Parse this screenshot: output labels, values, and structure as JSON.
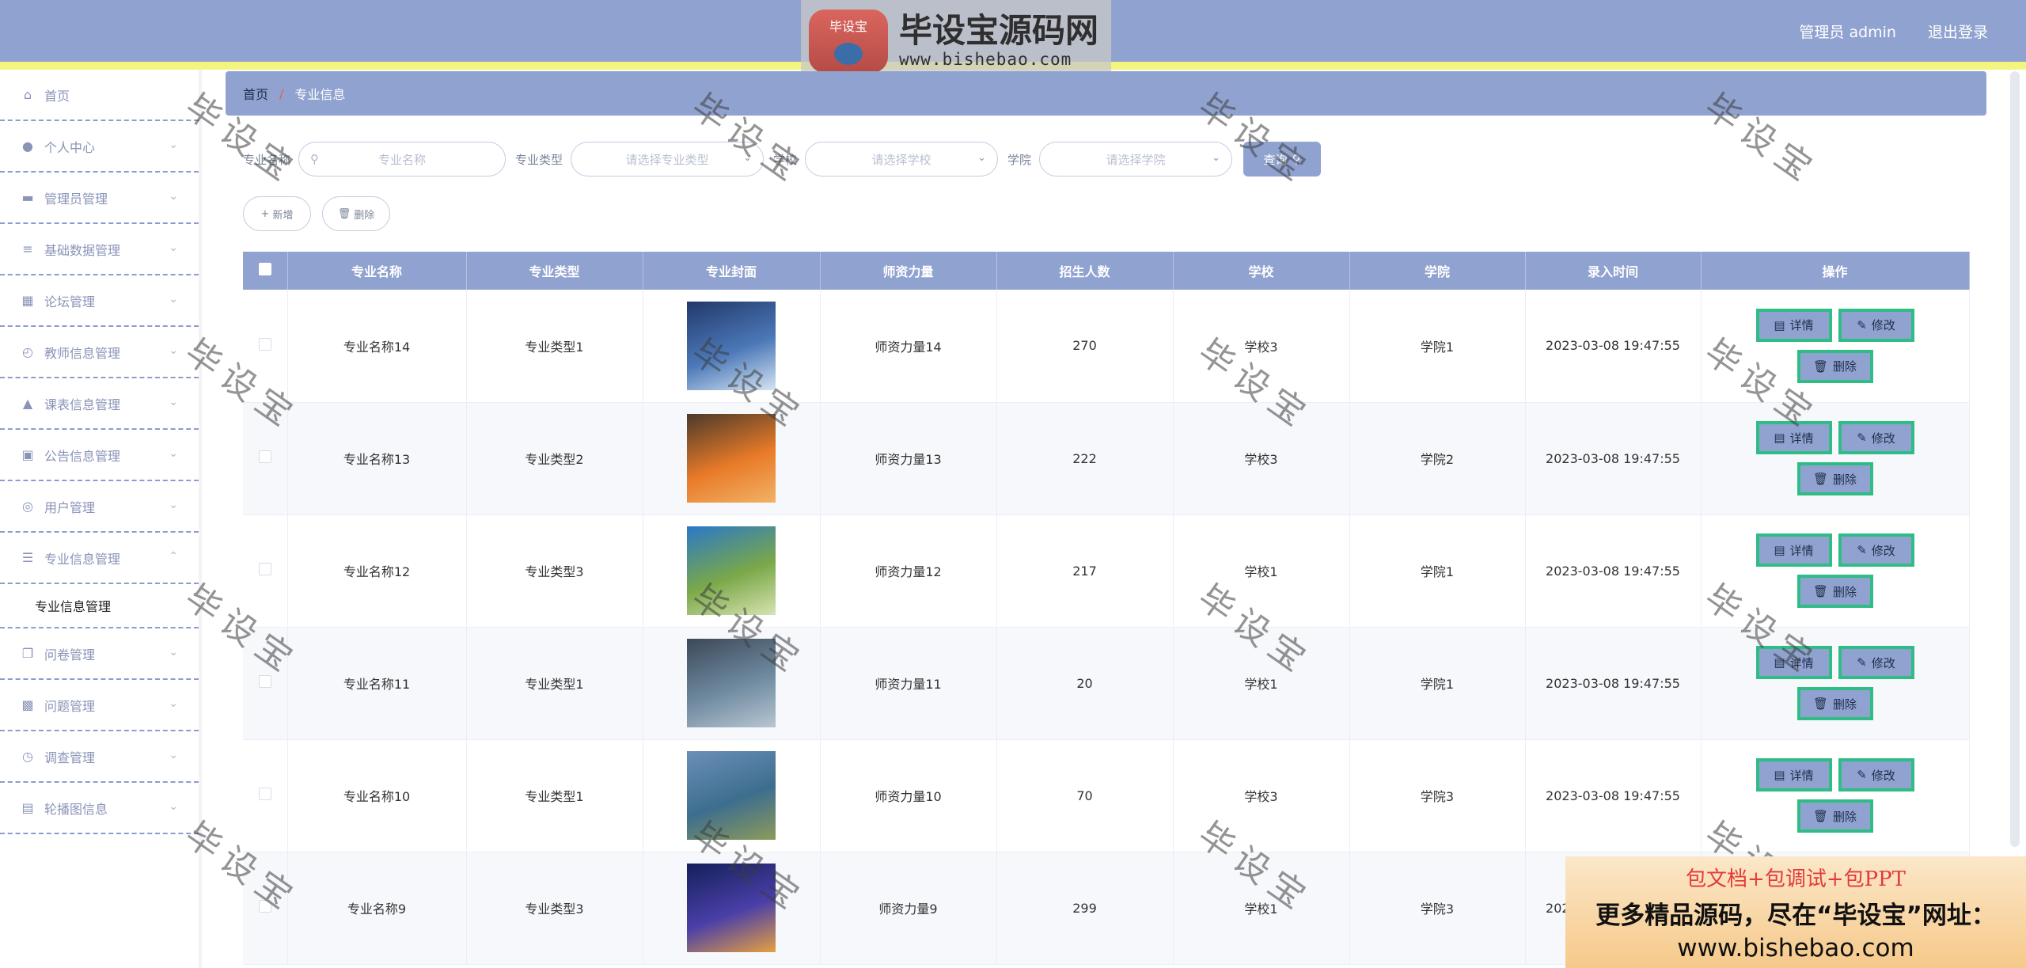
{
  "header": {
    "user_label": "管理员 admin",
    "logout_label": "退出登录"
  },
  "watermark": {
    "logo_badge": "毕设宝",
    "logo_title": "毕设宝源码网",
    "logo_url": "www.bishebao.com",
    "tile_text": "毕设宝"
  },
  "sidebar": {
    "items": [
      {
        "label": "首页",
        "icon": "home-icon"
      },
      {
        "label": "个人中心",
        "icon": "user-icon"
      },
      {
        "label": "管理员管理",
        "icon": "admin-icon"
      },
      {
        "label": "基础数据管理",
        "icon": "sliders-icon"
      },
      {
        "label": "论坛管理",
        "icon": "grid-icon"
      },
      {
        "label": "教师信息管理",
        "icon": "compass-icon"
      },
      {
        "label": "课表信息管理",
        "icon": "person-icon"
      },
      {
        "label": "公告信息管理",
        "icon": "monitor-icon"
      },
      {
        "label": "用户管理",
        "icon": "circle-icon"
      },
      {
        "label": "专业信息管理",
        "icon": "list-icon"
      },
      {
        "label": "问卷管理",
        "icon": "copy-icon"
      },
      {
        "label": "问题管理",
        "icon": "chat-icon"
      },
      {
        "label": "调查管理",
        "icon": "gauge-icon"
      },
      {
        "label": "轮播图信息",
        "icon": "briefcase-icon"
      }
    ],
    "submenu_active": "专业信息管理"
  },
  "breadcrumb": {
    "home": "首页",
    "separator": "/",
    "current": "专业信息"
  },
  "search": {
    "name_label": "专业名称",
    "name_placeholder": "专业名称",
    "type_label": "专业类型",
    "type_placeholder": "请选择专业类型",
    "school_label": "学校",
    "school_placeholder": "请选择学校",
    "college_label": "学院",
    "college_placeholder": "请选择学院",
    "button": "查询"
  },
  "actions": {
    "add": "新增",
    "delete": "删除"
  },
  "table": {
    "headers": [
      "专业名称",
      "专业类型",
      "专业封面",
      "师资力量",
      "招生人数",
      "学校",
      "学院",
      "录入时间",
      "操作"
    ],
    "ops": {
      "detail": "详情",
      "edit": "修改",
      "delete": "删除"
    },
    "rows": [
      {
        "name": "专业名称14",
        "type": "专业类型1",
        "teachers": "师资力量14",
        "count": "270",
        "school": "学校3",
        "college": "学院1",
        "time": "2023-03-08 19:47:55",
        "cover": [
          "#22386a",
          "#4b78b8",
          "#d6e4f2"
        ]
      },
      {
        "name": "专业名称13",
        "type": "专业类型2",
        "teachers": "师资力量13",
        "count": "222",
        "school": "学校3",
        "college": "学院2",
        "time": "2023-03-08 19:47:55",
        "cover": [
          "#4a3a2a",
          "#e87a28",
          "#f2b266"
        ]
      },
      {
        "name": "专业名称12",
        "type": "专业类型3",
        "teachers": "师资力量12",
        "count": "217",
        "school": "学校1",
        "college": "学院1",
        "time": "2023-03-08 19:47:55",
        "cover": [
          "#2a78c8",
          "#7aa848",
          "#d7e3b2"
        ]
      },
      {
        "name": "专业名称11",
        "type": "专业类型1",
        "teachers": "师资力量11",
        "count": "20",
        "school": "学校1",
        "college": "学院1",
        "time": "2023-03-08 19:47:55",
        "cover": [
          "#3c4858",
          "#6f8aa0",
          "#b8c6d2"
        ]
      },
      {
        "name": "专业名称10",
        "type": "专业类型1",
        "teachers": "师资力量10",
        "count": "70",
        "school": "学校3",
        "college": "学院3",
        "time": "2023-03-08 19:47:55",
        "cover": [
          "#6b8fb8",
          "#3d6e8e",
          "#8d9a5a"
        ]
      },
      {
        "name": "专业名称9",
        "type": "专业类型3",
        "teachers": "师资力量9",
        "count": "299",
        "school": "学校1",
        "college": "学院3",
        "time": "2023-03-08 19:47:55",
        "cover": [
          "#14205a",
          "#4a3fa8",
          "#e6a040"
        ]
      }
    ]
  },
  "ad": {
    "line1": "包文档+包调试+包PPT",
    "line2": "更多精品源码，尽在“毕设宝”网址：",
    "line3": "www.bishebao.com"
  }
}
